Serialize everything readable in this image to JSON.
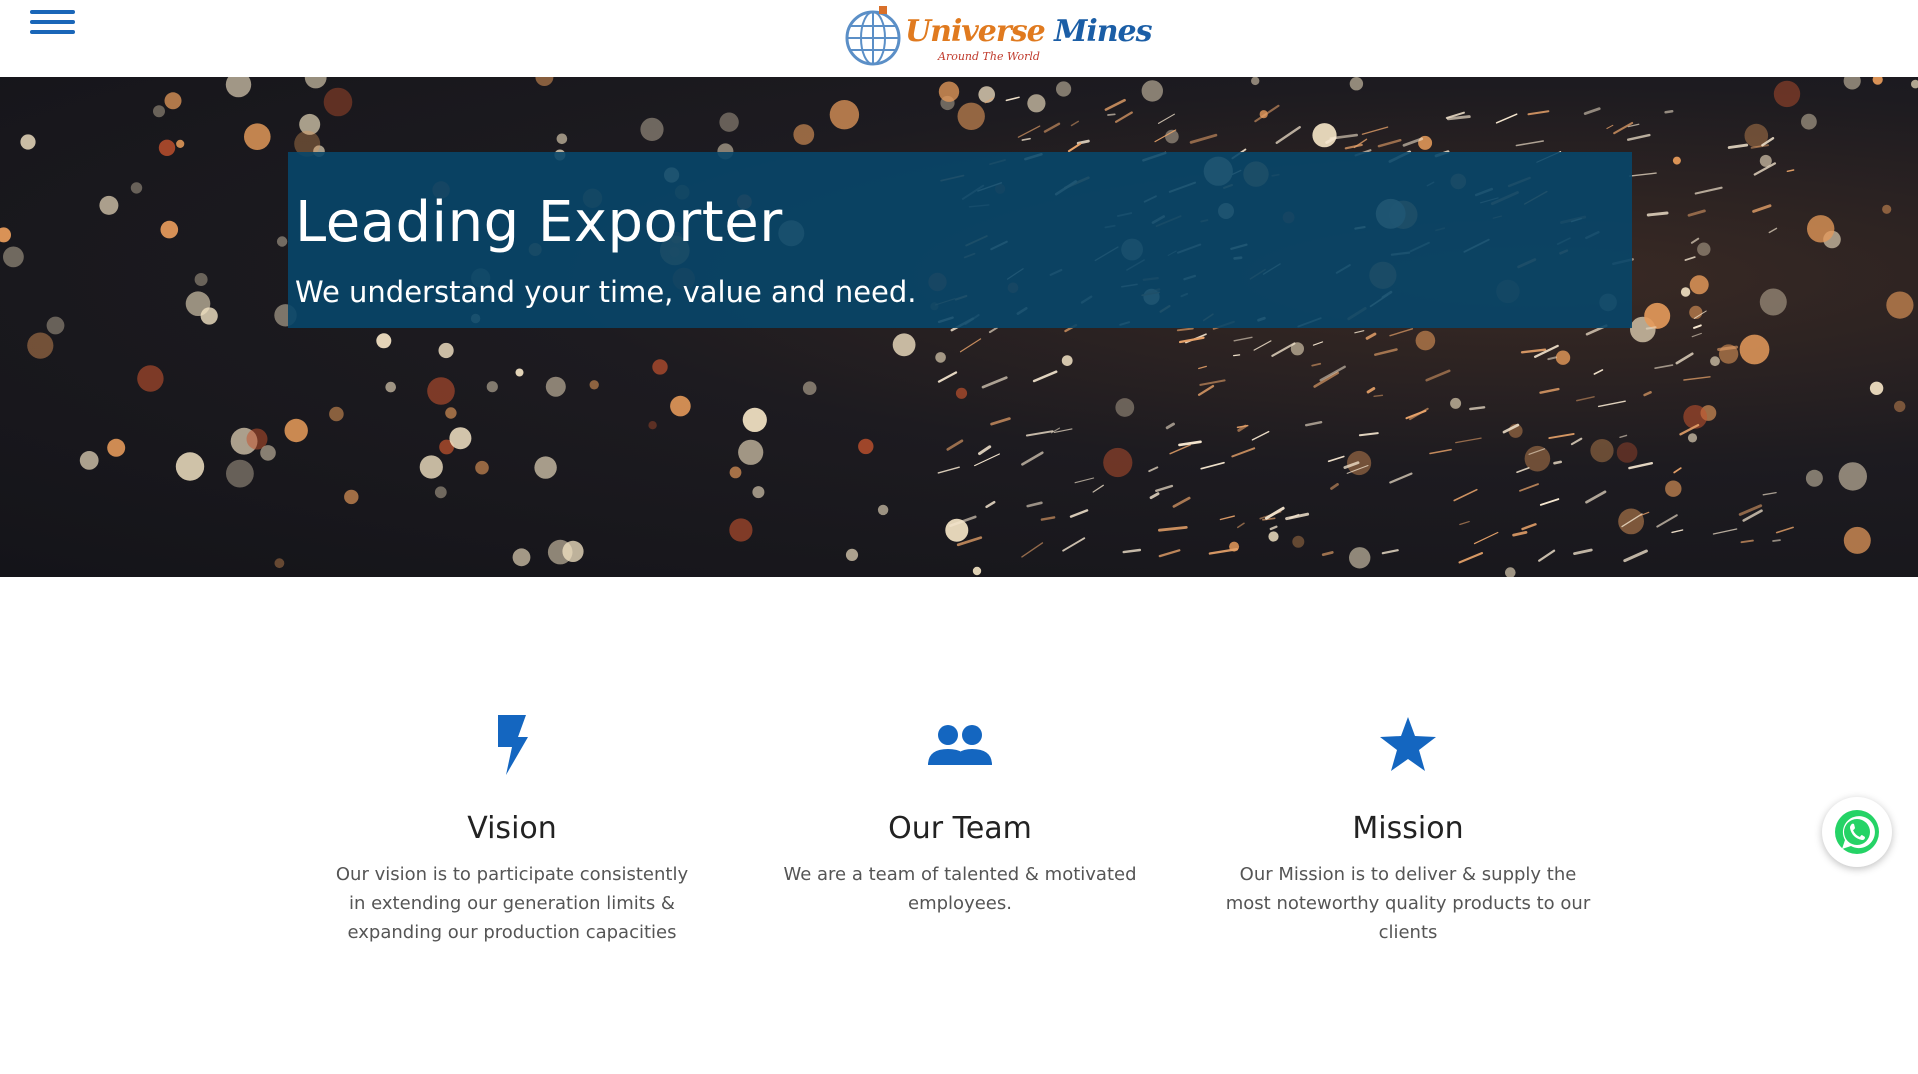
{
  "header": {
    "menu_icon": "hamburger-menu-icon",
    "logo": {
      "word1": "Universe",
      "word2": " Mines",
      "tagline": "Around The World",
      "globe_icon": "globe-icon"
    }
  },
  "hero": {
    "title": "Leading Exporter",
    "subtitle": "We understand your time, value and need."
  },
  "features": [
    {
      "icon": "lightning-bolt-icon",
      "title": "Vision",
      "text": "Our vision is to participate consistently in extending our generation limits & expanding our production capacities"
    },
    {
      "icon": "people-icon",
      "title": "Our Team",
      "text": "We are a team of talented & motivated employees."
    },
    {
      "icon": "star-icon",
      "title": "Mission",
      "text": "Our Mission is to deliver & supply the most noteworthy quality products to our clients"
    }
  ],
  "whatsapp": {
    "icon": "whatsapp-icon"
  },
  "colors": {
    "accent": "#1a66b8",
    "hero_box": "#084669",
    "icon_blue": "#1466c0",
    "whatsapp_green": "#25d366"
  }
}
